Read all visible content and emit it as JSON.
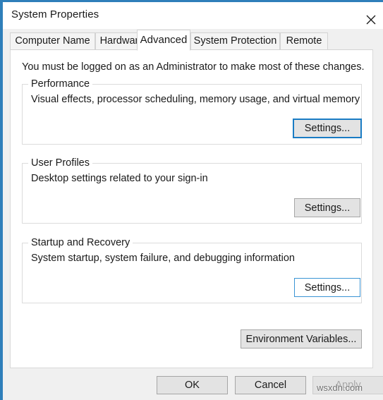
{
  "window": {
    "title": "System Properties",
    "close_icon": "close-icon",
    "accent_color": "#2f7fba"
  },
  "tabs": [
    {
      "label": "Computer Name",
      "active": false
    },
    {
      "label": "Hardware",
      "active": false
    },
    {
      "label": "Advanced",
      "active": true
    },
    {
      "label": "System Protection",
      "active": false
    },
    {
      "label": "Remote",
      "active": false
    }
  ],
  "content": {
    "intro": "You must be logged on as an Administrator to make most of these changes.",
    "groups": [
      {
        "label": "Performance",
        "description": "Visual effects, processor scheduling, memory usage, and virtual memory",
        "button_label": "Settings...",
        "button_state": "focused"
      },
      {
        "label": "User Profiles",
        "description": "Desktop settings related to your sign-in",
        "button_label": "Settings...",
        "button_state": "normal"
      },
      {
        "label": "Startup and Recovery",
        "description": "System startup, system failure, and debugging information",
        "button_label": "Settings...",
        "button_state": "hover"
      }
    ],
    "environment_variables_label": "Environment Variables..."
  },
  "footer": {
    "ok_label": "OK",
    "cancel_label": "Cancel",
    "apply_label": "Apply",
    "apply_disabled": true
  },
  "watermark": "wsxdn.com"
}
